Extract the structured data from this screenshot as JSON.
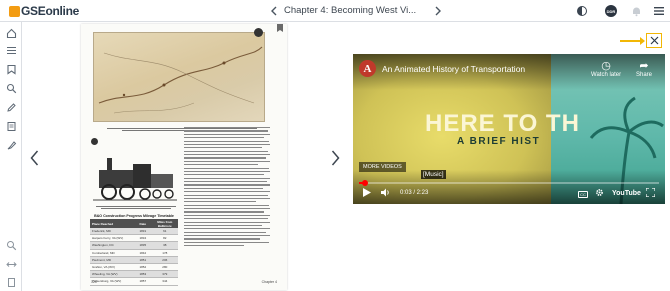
{
  "header": {
    "logo_text": "GSEonline",
    "chapter_title": "Chapter 4: Becoming West Vi...",
    "prev_icon": "chevron-left-icon",
    "next_icon": "chevron-right-icon",
    "avatar_initials": "DDR"
  },
  "sidebar": {
    "items": [
      {
        "icon": "home-icon"
      },
      {
        "icon": "list-icon"
      },
      {
        "icon": "bookmark-icon"
      },
      {
        "icon": "search-icon"
      },
      {
        "icon": "pencil-icon"
      },
      {
        "icon": "notes-icon"
      },
      {
        "icon": "highlighter-icon"
      },
      {
        "icon": "zoom-icon"
      },
      {
        "icon": "fit-width-icon"
      },
      {
        "icon": "single-page-icon"
      },
      {
        "icon": "grid-icon"
      }
    ]
  },
  "page": {
    "table_title": "B&O Construction Progress Mileage Timetable",
    "columns": [
      "Place Reached",
      "Date",
      "Miles from Baltimore"
    ],
    "rows": [
      [
        "Frederick, MD",
        "1831",
        "61"
      ],
      [
        "Harpers Ferry, VA (WV)",
        "1834",
        "82"
      ],
      [
        "Washington, DC",
        "1835",
        "38"
      ],
      [
        "Cumberland, MD",
        "1842",
        "178"
      ],
      [
        "Piedmont, MD",
        "1851",
        "206"
      ],
      [
        "Grafton, VA (WV)",
        "1852",
        "280"
      ],
      [
        "Wheeling, VA (WV)",
        "1853",
        "379"
      ],
      [
        "Parkersburg, VA (WV)",
        "1857",
        "344"
      ]
    ],
    "page_number": "120",
    "page_chapter": "Chapter 4"
  },
  "video": {
    "title": "An Animated History of Transportation",
    "channel_letter": "A",
    "watch_later_label": "Watch later",
    "share_label": "Share",
    "big_title": "HERE TO TH",
    "subtitle": "A BRIEF HIST",
    "more_videos_label": "MORE VIDEOS",
    "caption_text": "[Music]",
    "time_display": "0:03 / 2:23",
    "progress": 0.02,
    "platform_label": "YouTube",
    "accent_color": "#ff0000"
  },
  "annotation": {
    "color": "#f2b705"
  }
}
